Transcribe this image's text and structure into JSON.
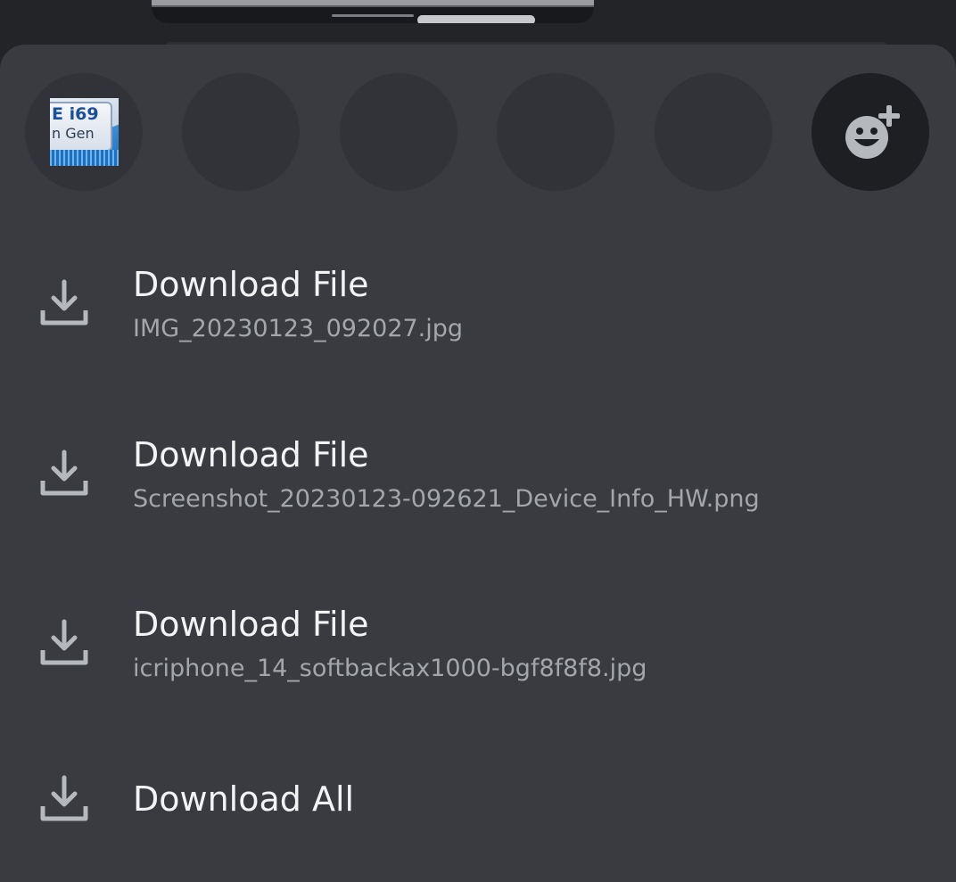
{
  "reactions_bar": {
    "first_reaction": {
      "icon": "cpu-chip-emoji-icon",
      "chip_line1": "E i69",
      "chip_line2": "n Gen"
    },
    "add_reaction_icon": "add-reaction-icon"
  },
  "actions": [
    {
      "title": "Download File",
      "subtitle": "IMG_20230123_092027.jpg",
      "icon": "download-icon"
    },
    {
      "title": "Download File",
      "subtitle": "Screenshot_20230123-092621_Device_Info_HW.png",
      "icon": "download-icon"
    },
    {
      "title": "Download File",
      "subtitle": "icriphone_14_softbackax1000-bgf8f8f8.jpg",
      "icon": "download-icon"
    },
    {
      "title": "Download All",
      "icon": "download-icon"
    }
  ],
  "colors": {
    "sheet_background": "#393b40",
    "reaction_background": "#313338",
    "add_reaction_background": "#1e1f22",
    "title_text": "#f2f3f5",
    "subtitle_text": "#a3a6ab",
    "icon_color": "#b5b8bd"
  }
}
